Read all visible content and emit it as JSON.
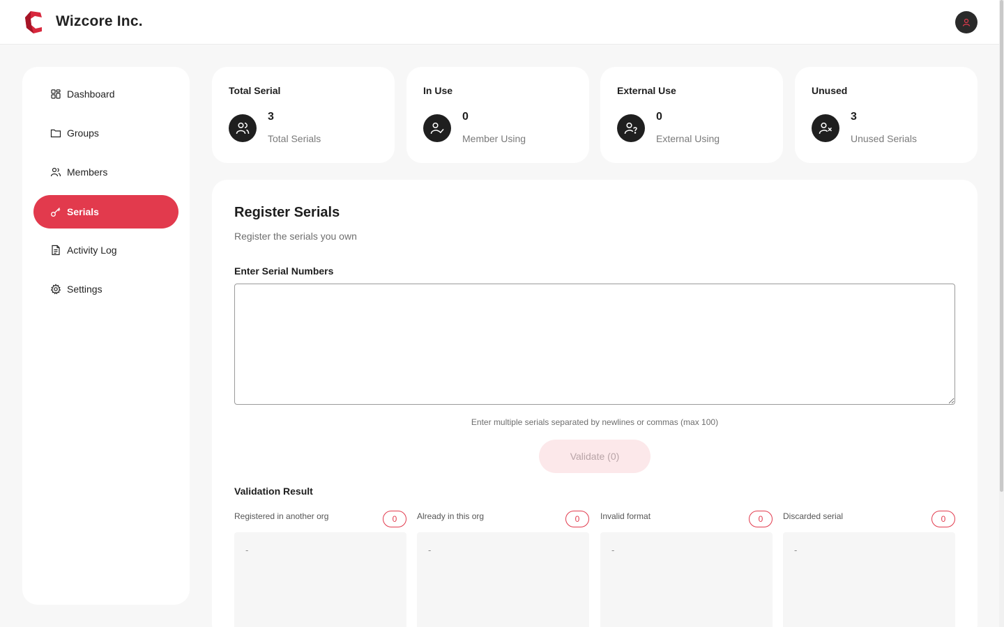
{
  "app": {
    "brand": "Wizcore Inc."
  },
  "sidebar": {
    "items": [
      {
        "label": "Dashboard",
        "icon": "dashboard-icon",
        "active": false
      },
      {
        "label": "Groups",
        "icon": "folder-icon",
        "active": false
      },
      {
        "label": "Members",
        "icon": "users-icon",
        "active": false
      },
      {
        "label": "Serials",
        "icon": "key-icon",
        "active": true
      },
      {
        "label": "Activity Log",
        "icon": "document-icon",
        "active": false
      },
      {
        "label": "Settings",
        "icon": "gear-icon",
        "active": false
      }
    ]
  },
  "stats": [
    {
      "title": "Total Serial",
      "value": "3",
      "label": "Total Serials",
      "icon": "users-icon"
    },
    {
      "title": "In Use",
      "value": "0",
      "label": "Member Using",
      "icon": "user-check-icon"
    },
    {
      "title": "External Use",
      "value": "0",
      "label": "External Using",
      "icon": "user-question-icon"
    },
    {
      "title": "Unused",
      "value": "3",
      "label": "Unused Serials",
      "icon": "user-x-icon"
    }
  ],
  "register": {
    "title": "Register Serials",
    "subtitle": "Register the serials you own",
    "field_label": "Enter Serial Numbers",
    "input_value": "",
    "helper": "Enter multiple serials separated by newlines or commas (max 100)",
    "validate_label": "Validate (0)"
  },
  "validation": {
    "title": "Validation Result",
    "columns": [
      {
        "label": "Registered in another org",
        "count": "0",
        "empty": "-"
      },
      {
        "label": "Already in this org",
        "count": "0",
        "empty": "-"
      },
      {
        "label": "Invalid format",
        "count": "0",
        "empty": "-"
      },
      {
        "label": "Discarded serial",
        "count": "0",
        "empty": "-"
      }
    ]
  },
  "colors": {
    "accent": "#e23a4d",
    "dark": "#1f1f1f",
    "background": "#f7f7f7"
  }
}
